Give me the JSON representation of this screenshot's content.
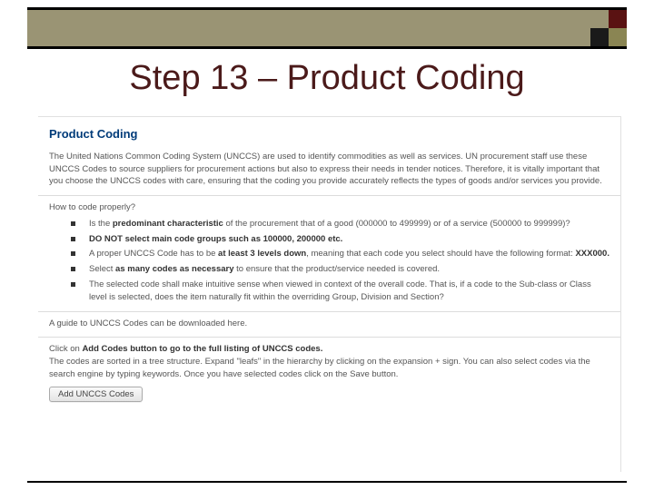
{
  "slide": {
    "title": "Step 13 – Product Coding"
  },
  "content": {
    "heading": "Product Coding",
    "intro": "The United Nations Common Coding System (UNCCS) are used to identify commodities as well as services. UN procurement staff use these UNCCS Codes to source suppliers for procurement actions but also to express their needs in tender notices. Therefore, it is vitally important that you choose the UNCCS codes with care, ensuring that the coding you provide accurately reflects the types of goods and/or services you provide.",
    "howto": "How to code properly?",
    "bullets": {
      "b1": {
        "pre": "Is the ",
        "bold": "predominant characteristic",
        "post": " of the procurement that of a good (000000 to 499999) or of a service (500000 to 999999)?"
      },
      "b2": {
        "bold": "DO NOT select main code groups such as 100000, 200000 etc."
      },
      "b3": {
        "pre": "A proper UNCCS Code has to be ",
        "bold1": "at least 3 levels down",
        "mid": ", meaning that each code you select should have the following format: ",
        "bold2": "XXX000.",
        "post": ""
      },
      "b4": {
        "pre": "Select ",
        "bold": "as many codes as necessary",
        "post": " to ensure that the product/service needed is covered."
      },
      "b5": {
        "text": "The selected code shall make intuitive sense when viewed in context of the overall code. That is, if a code to the Sub-class or Class level is selected, does the item naturally fit within the overriding Group, Division and Section?"
      }
    },
    "guide": "A guide to UNCCS Codes can be downloaded here.",
    "clickon": {
      "pre": "Click on ",
      "bold": "Add Codes button to go to the full listing of UNCCS codes.",
      "post": " The codes are sorted in a tree structure. Expand \"leafs\" in the hierarchy by clicking on the expansion + sign. You can also select codes via the search engine by typing keywords. Once you have selected codes click on the Save button."
    },
    "button": "Add UNCCS Codes"
  }
}
